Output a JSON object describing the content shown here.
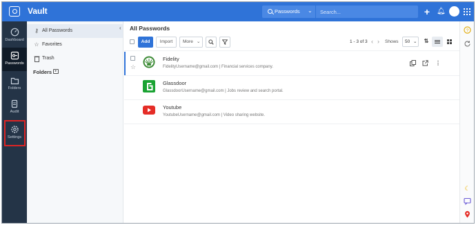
{
  "app": {
    "title": "Vault"
  },
  "topbar": {
    "search_scope": "Passwords",
    "search_placeholder": "Search...",
    "add_icon": "plus-icon",
    "notifications_icon": "bell-icon",
    "apps_icon": "grid-icon"
  },
  "leftnav": {
    "items": [
      {
        "label": "Dashboard",
        "icon": "gauge-icon"
      },
      {
        "label": "Passwords",
        "icon": "key-icon"
      },
      {
        "label": "Folders",
        "icon": "folder-icon"
      },
      {
        "label": "Audit",
        "icon": "audit-icon"
      },
      {
        "label": "Settings",
        "icon": "gear-icon"
      }
    ],
    "active": "Passwords",
    "highlighted": "Settings"
  },
  "subpanel": {
    "items": [
      {
        "label": "All Passwords",
        "icon": "key-icon"
      },
      {
        "label": "Favorites",
        "icon": "star-icon"
      },
      {
        "label": "Trash",
        "icon": "trash-icon"
      }
    ],
    "folders_label": "Folders"
  },
  "main": {
    "title": "All Passwords",
    "toolbar": {
      "add_label": "Add",
      "import_label": "Import",
      "more_label": "More"
    },
    "pager": {
      "range": "1 - 3 of 3",
      "shows_label": "Shows",
      "page_size": "50"
    },
    "rows": [
      {
        "name": "Fidelity",
        "detail": "FidelityUsername@gmail.com | Financial services company."
      },
      {
        "name": "Glassdoor",
        "detail": "GlassdoorUsername@gmail.com | Jobs review and search portal."
      },
      {
        "name": "Youtube",
        "detail": "YoutubeUsername@gmail.com | Video sharing website."
      }
    ]
  },
  "colors": {
    "accent": "#2f73d8",
    "nav_bg": "#243447",
    "highlight": "#e02424",
    "fidelity": "#3b8a34",
    "glassdoor": "#1aa333",
    "youtube": "#e52d27"
  }
}
